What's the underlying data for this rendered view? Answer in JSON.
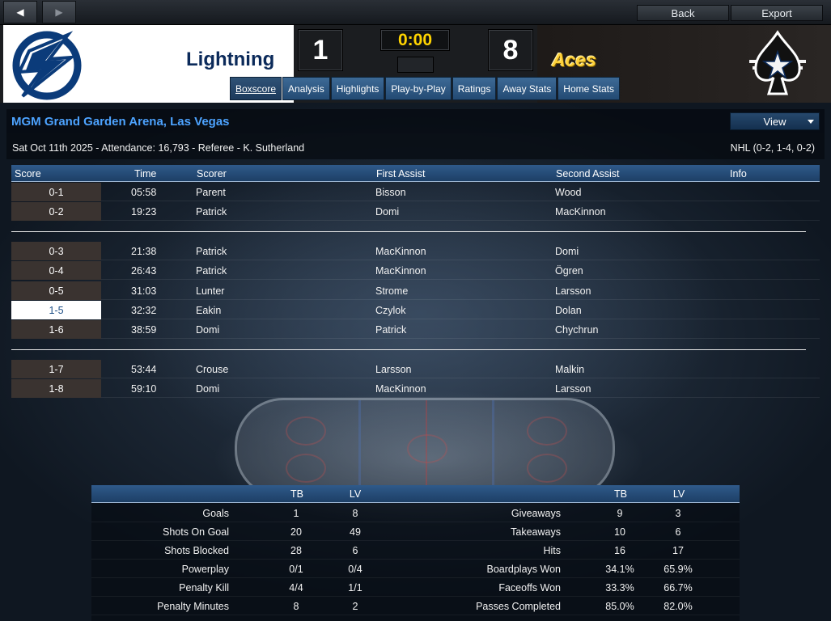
{
  "toolbar": {
    "back_label": "Back",
    "export_label": "Export"
  },
  "header": {
    "home_team": "Lightning",
    "away_team": "Aces",
    "home_score": "1",
    "away_score": "8",
    "clock": "0:00",
    "tabs": [
      {
        "label": "Boxscore",
        "active": true
      },
      {
        "label": "Analysis"
      },
      {
        "label": "Highlights"
      },
      {
        "label": "Play-by-Play"
      },
      {
        "label": "Ratings"
      },
      {
        "label": "Away Stats"
      },
      {
        "label": "Home Stats"
      }
    ]
  },
  "game": {
    "venue": "MGM Grand Garden Arena, Las Vegas",
    "view_label": "View",
    "details": "Sat Oct 11th 2025 - Attendance: 16,793 - Referee - K. Sutherland",
    "league_record": "NHL (0-2, 1-4, 0-2)"
  },
  "goals": {
    "columns": [
      "Score",
      "Time",
      "Scorer",
      "First Assist",
      "Second Assist",
      "Info"
    ],
    "rows": [
      {
        "score": "0-1",
        "time": "05:58",
        "scorer": "Parent",
        "assist1": "Bisson",
        "assist2": "Wood",
        "home": false
      },
      {
        "score": "0-2",
        "time": "19:23",
        "scorer": "Patrick",
        "assist1": "Domi",
        "assist2": "MacKinnon",
        "home": false
      },
      {
        "score": "0-3",
        "time": "21:38",
        "scorer": "Patrick",
        "assist1": "MacKinnon",
        "assist2": "Domi",
        "home": false
      },
      {
        "score": "0-4",
        "time": "26:43",
        "scorer": "Patrick",
        "assist1": "MacKinnon",
        "assist2": "Ögren",
        "home": false
      },
      {
        "score": "0-5",
        "time": "31:03",
        "scorer": "Lunter",
        "assist1": "Strome",
        "assist2": "Larsson",
        "home": false
      },
      {
        "score": "1-5",
        "time": "32:32",
        "scorer": "Eakin",
        "assist1": "Czylok",
        "assist2": "Dolan",
        "home": true
      },
      {
        "score": "1-6",
        "time": "38:59",
        "scorer": "Domi",
        "assist1": "Patrick",
        "assist2": "Chychrun",
        "home": false
      },
      {
        "score": "1-7",
        "time": "53:44",
        "scorer": "Crouse",
        "assist1": "Larsson",
        "assist2": "Malkin",
        "home": false
      },
      {
        "score": "1-8",
        "time": "59:10",
        "scorer": "Domi",
        "assist1": "MacKinnon",
        "assist2": "Larsson",
        "home": false
      }
    ]
  },
  "stats": {
    "home_abbr": "TB",
    "away_abbr": "LV",
    "left": [
      {
        "label": "Goals",
        "home": "1",
        "away": "8"
      },
      {
        "label": "Shots On Goal",
        "home": "20",
        "away": "49"
      },
      {
        "label": "Shots Blocked",
        "home": "28",
        "away": "6"
      },
      {
        "label": "Powerplay",
        "home": "0/1",
        "away": "0/4"
      },
      {
        "label": "Penalty Kill",
        "home": "4/4",
        "away": "1/1"
      },
      {
        "label": "Penalty Minutes",
        "home": "8",
        "away": "2"
      }
    ],
    "right": [
      {
        "label": "Giveaways",
        "home": "9",
        "away": "3"
      },
      {
        "label": "Takeaways",
        "home": "10",
        "away": "6"
      },
      {
        "label": "Hits",
        "home": "16",
        "away": "17"
      },
      {
        "label": "Boardplays Won",
        "home": "34.1%",
        "away": "65.9%"
      },
      {
        "label": "Faceoffs Won",
        "home": "33.3%",
        "away": "66.7%"
      },
      {
        "label": "Passes Completed",
        "home": "85.0%",
        "away": "82.0%"
      }
    ]
  },
  "colors": {
    "accent": "#4da3ff",
    "home_brand": "#0b2a5a",
    "away_brand": "#ffd23a",
    "clock": "#ffd400"
  },
  "icons": {
    "back": "arrow-left-icon",
    "forward": "arrow-right-icon",
    "home_logo": "lightning-bolt-logo",
    "away_logo": "spade-star-logo"
  }
}
